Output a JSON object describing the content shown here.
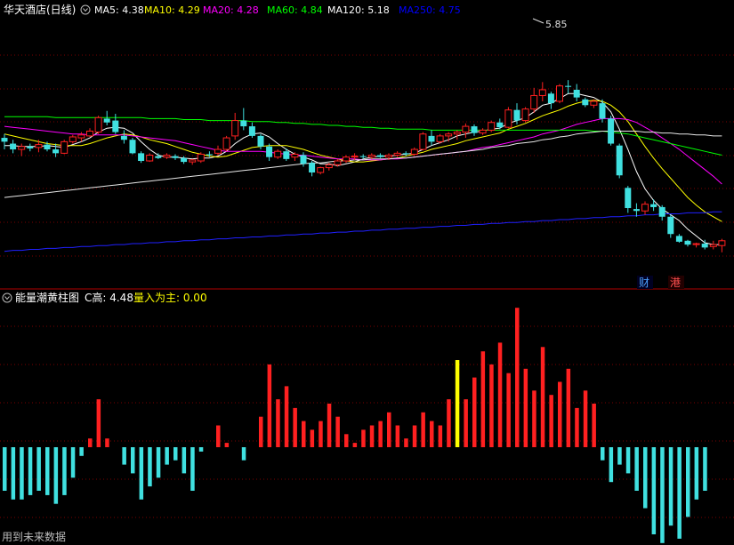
{
  "main_chart": {
    "stock_name": "华天酒店(日线)",
    "ma_legend": [
      {
        "label": "MA5: 4.38",
        "color": "#ffffff"
      },
      {
        "label": "MA10: 4.29",
        "color": "#ffff00"
      },
      {
        "label": "MA20: 4.28",
        "color": "#ff00ff"
      },
      {
        "label": "MA60: 4.84",
        "color": "#00ff00"
      },
      {
        "label": "MA120: 5.18",
        "color": "#ffffff"
      },
      {
        "label": "MA250: 4.75",
        "color": "#0000ff"
      }
    ],
    "high_marker": "5.85",
    "badge_cai": "财",
    "badge_gang": "港"
  },
  "indicator": {
    "name": "能量潮黄柱图",
    "c_high": "C高: 4.48",
    "main_flow": "量入为主: 0.00",
    "footer_note": "用到未来数据"
  },
  "colors": {
    "bg": "#000000",
    "border": "#b00000",
    "grid": "#7a0000",
    "up": "#ff2020",
    "down": "#40e0e0",
    "yellow_bar": "#ffff00"
  },
  "chart_data": {
    "type": "candlestick",
    "candles": [
      [
        4.72,
        4.76,
        4.6,
        4.68
      ],
      [
        4.66,
        4.7,
        4.56,
        4.6
      ],
      [
        4.6,
        4.66,
        4.53,
        4.63
      ],
      [
        4.63,
        4.66,
        4.58,
        4.61
      ],
      [
        4.62,
        4.7,
        4.57,
        4.65
      ],
      [
        4.65,
        4.68,
        4.58,
        4.6
      ],
      [
        4.6,
        4.66,
        4.52,
        4.56
      ],
      [
        4.56,
        4.7,
        4.55,
        4.68
      ],
      [
        4.68,
        4.75,
        4.66,
        4.73
      ],
      [
        4.72,
        4.78,
        4.68,
        4.75
      ],
      [
        4.74,
        4.82,
        4.73,
        4.79
      ],
      [
        4.78,
        4.95,
        4.76,
        4.93
      ],
      [
        4.92,
        5.0,
        4.85,
        4.88
      ],
      [
        4.9,
        4.97,
        4.76,
        4.78
      ],
      [
        4.74,
        4.8,
        4.66,
        4.7
      ],
      [
        4.7,
        4.72,
        4.55,
        4.56
      ],
      [
        4.56,
        4.58,
        4.46,
        4.48
      ],
      [
        4.48,
        4.56,
        4.47,
        4.54
      ],
      [
        4.53,
        4.56,
        4.5,
        4.51
      ],
      [
        4.52,
        4.56,
        4.5,
        4.54
      ],
      [
        4.53,
        4.55,
        4.49,
        4.51
      ],
      [
        4.51,
        4.53,
        4.45,
        4.47
      ],
      [
        4.47,
        4.5,
        4.44,
        4.49
      ],
      [
        4.48,
        4.57,
        4.46,
        4.55
      ],
      [
        4.55,
        4.58,
        4.52,
        4.54
      ],
      [
        4.56,
        4.64,
        4.54,
        4.6
      ],
      [
        4.6,
        4.74,
        4.58,
        4.72
      ],
      [
        4.74,
        4.98,
        4.7,
        4.9
      ],
      [
        4.9,
        5.03,
        4.8,
        4.84
      ],
      [
        4.84,
        4.88,
        4.72,
        4.74
      ],
      [
        4.74,
        4.76,
        4.6,
        4.63
      ],
      [
        4.63,
        4.66,
        4.48,
        4.52
      ],
      [
        4.52,
        4.6,
        4.5,
        4.58
      ],
      [
        4.58,
        4.61,
        4.48,
        4.5
      ],
      [
        4.52,
        4.57,
        4.48,
        4.55
      ],
      [
        4.54,
        4.57,
        4.42,
        4.45
      ],
      [
        4.46,
        4.48,
        4.32,
        4.36
      ],
      [
        4.36,
        4.42,
        4.34,
        4.41
      ],
      [
        4.41,
        4.46,
        4.38,
        4.44
      ],
      [
        4.44,
        4.5,
        4.42,
        4.48
      ],
      [
        4.48,
        4.54,
        4.46,
        4.52
      ],
      [
        4.52,
        4.56,
        4.49,
        4.53
      ],
      [
        4.53,
        4.55,
        4.5,
        4.52
      ],
      [
        4.52,
        4.56,
        4.5,
        4.54
      ],
      [
        4.54,
        4.56,
        4.51,
        4.52
      ],
      [
        4.52,
        4.56,
        4.49,
        4.54
      ],
      [
        4.54,
        4.58,
        4.52,
        4.56
      ],
      [
        4.56,
        4.58,
        4.53,
        4.55
      ],
      [
        4.55,
        4.62,
        4.53,
        4.6
      ],
      [
        4.6,
        4.78,
        4.59,
        4.76
      ],
      [
        4.74,
        4.8,
        4.64,
        4.68
      ],
      [
        4.68,
        4.76,
        4.66,
        4.74
      ],
      [
        4.74,
        4.78,
        4.68,
        4.76
      ],
      [
        4.76,
        4.8,
        4.7,
        4.78
      ],
      [
        4.78,
        4.87,
        4.72,
        4.84
      ],
      [
        4.84,
        4.86,
        4.74,
        4.77
      ],
      [
        4.77,
        4.82,
        4.75,
        4.8
      ],
      [
        4.8,
        4.9,
        4.78,
        4.88
      ],
      [
        4.88,
        4.92,
        4.81,
        4.83
      ],
      [
        4.83,
        5.04,
        4.82,
        5.01
      ],
      [
        5.01,
        5.08,
        4.86,
        4.9
      ],
      [
        4.9,
        5.04,
        4.88,
        5.02
      ],
      [
        5.02,
        5.24,
        4.98,
        5.16
      ],
      [
        5.16,
        5.3,
        5.1,
        5.22
      ],
      [
        5.18,
        5.2,
        5.02,
        5.08
      ],
      [
        5.1,
        5.28,
        5.08,
        5.26
      ],
      [
        5.26,
        5.32,
        5.18,
        5.25
      ],
      [
        5.22,
        5.28,
        5.1,
        5.14
      ],
      [
        5.12,
        5.14,
        5.04,
        5.06
      ],
      [
        5.06,
        5.12,
        5.03,
        5.1
      ],
      [
        5.08,
        5.12,
        4.88,
        4.92
      ],
      [
        4.92,
        4.95,
        4.64,
        4.66
      ],
      [
        4.64,
        4.66,
        4.3,
        4.33
      ],
      [
        4.2,
        4.22,
        3.94,
        3.99
      ],
      [
        3.98,
        4.04,
        3.9,
        3.96
      ],
      [
        3.96,
        4.06,
        3.92,
        4.03
      ],
      [
        4.03,
        4.08,
        3.96,
        4.0
      ],
      [
        4.0,
        4.02,
        3.86,
        3.9
      ],
      [
        3.9,
        3.92,
        3.68,
        3.72
      ],
      [
        3.7,
        3.72,
        3.63,
        3.64
      ],
      [
        3.65,
        3.66,
        3.59,
        3.61
      ],
      [
        3.61,
        3.63,
        3.58,
        3.62
      ],
      [
        3.62,
        3.66,
        3.56,
        3.58
      ],
      [
        3.59,
        3.65,
        3.56,
        3.61
      ],
      [
        3.6,
        3.67,
        3.53,
        3.65
      ]
    ],
    "ma": {
      "MA5": [
        4.64,
        4.64,
        4.63,
        4.63,
        4.63,
        4.64,
        4.63,
        4.62,
        4.65,
        4.68,
        4.72,
        4.78,
        4.82,
        4.83,
        4.82,
        4.77,
        4.68,
        4.6,
        4.54,
        4.52,
        4.52,
        4.51,
        4.5,
        4.51,
        4.51,
        4.53,
        4.58,
        4.66,
        4.72,
        4.76,
        4.77,
        4.73,
        4.66,
        4.6,
        4.55,
        4.52,
        4.49,
        4.45,
        4.45,
        4.43,
        4.45,
        4.47,
        4.5,
        4.52,
        4.53,
        4.53,
        4.54,
        4.55,
        4.56,
        4.6,
        4.64,
        4.67,
        4.7,
        4.74,
        4.76,
        4.78,
        4.79,
        4.81,
        4.82,
        4.87,
        4.9,
        4.93,
        4.99,
        5.06,
        5.08,
        5.13,
        5.18,
        5.18,
        5.16,
        5.14,
        5.09,
        4.99,
        4.81,
        4.6,
        4.37,
        4.19,
        4.07,
        3.98,
        3.92,
        3.86,
        3.77,
        3.7,
        3.63,
        3.61,
        3.61
      ],
      "MA10": [
        4.76,
        4.74,
        4.72,
        4.7,
        4.68,
        4.66,
        4.65,
        4.64,
        4.64,
        4.64,
        4.66,
        4.69,
        4.72,
        4.74,
        4.76,
        4.75,
        4.73,
        4.7,
        4.68,
        4.66,
        4.63,
        4.6,
        4.57,
        4.55,
        4.53,
        4.52,
        4.53,
        4.56,
        4.59,
        4.62,
        4.63,
        4.64,
        4.64,
        4.64,
        4.62,
        4.6,
        4.57,
        4.54,
        4.52,
        4.5,
        4.48,
        4.47,
        4.47,
        4.48,
        4.49,
        4.5,
        4.51,
        4.53,
        4.55,
        4.57,
        4.6,
        4.62,
        4.64,
        4.66,
        4.69,
        4.71,
        4.73,
        4.75,
        4.77,
        4.81,
        4.84,
        4.87,
        4.91,
        4.95,
        4.98,
        5.01,
        5.05,
        5.08,
        5.1,
        5.11,
        5.1,
        5.06,
        4.99,
        4.89,
        4.76,
        4.63,
        4.51,
        4.4,
        4.3,
        4.2,
        4.1,
        4.02,
        3.95,
        3.9,
        3.85
      ],
      "MA20": [
        4.84,
        4.83,
        4.82,
        4.81,
        4.8,
        4.79,
        4.78,
        4.77,
        4.76,
        4.76,
        4.75,
        4.75,
        4.75,
        4.75,
        4.75,
        4.74,
        4.73,
        4.72,
        4.71,
        4.7,
        4.69,
        4.67,
        4.65,
        4.63,
        4.61,
        4.59,
        4.58,
        4.58,
        4.58,
        4.58,
        4.58,
        4.57,
        4.56,
        4.55,
        4.54,
        4.54,
        4.53,
        4.52,
        4.51,
        4.5,
        4.5,
        4.5,
        4.49,
        4.49,
        4.49,
        4.5,
        4.5,
        4.51,
        4.52,
        4.53,
        4.54,
        4.55,
        4.56,
        4.57,
        4.58,
        4.6,
        4.62,
        4.63,
        4.65,
        4.67,
        4.69,
        4.71,
        4.73,
        4.76,
        4.78,
        4.8,
        4.83,
        4.86,
        4.88,
        4.9,
        4.92,
        4.92,
        4.92,
        4.91,
        4.88,
        4.83,
        4.78,
        4.72,
        4.66,
        4.6,
        4.53,
        4.46,
        4.39,
        4.32,
        4.24
      ],
      "MA60": [
        4.94,
        4.94,
        4.94,
        4.94,
        4.94,
        4.94,
        4.93,
        4.93,
        4.93,
        4.93,
        4.93,
        4.93,
        4.93,
        4.93,
        4.93,
        4.93,
        4.93,
        4.92,
        4.92,
        4.92,
        4.92,
        4.91,
        4.91,
        4.91,
        4.9,
        4.9,
        4.9,
        4.9,
        4.9,
        4.89,
        4.89,
        4.89,
        4.88,
        4.88,
        4.87,
        4.87,
        4.86,
        4.86,
        4.85,
        4.85,
        4.84,
        4.84,
        4.83,
        4.83,
        4.82,
        4.82,
        4.81,
        4.81,
        4.81,
        4.81,
        4.8,
        4.8,
        4.8,
        4.8,
        4.8,
        4.8,
        4.8,
        4.8,
        4.8,
        4.8,
        4.8,
        4.8,
        4.8,
        4.8,
        4.8,
        4.8,
        4.8,
        4.8,
        4.8,
        4.79,
        4.79,
        4.78,
        4.77,
        4.76,
        4.74,
        4.72,
        4.7,
        4.68,
        4.66,
        4.64,
        4.62,
        4.6,
        4.58,
        4.56,
        4.54
      ],
      "MA120": [
        4.1,
        4.11,
        4.12,
        4.13,
        4.14,
        4.15,
        4.16,
        4.17,
        4.18,
        4.19,
        4.2,
        4.21,
        4.22,
        4.23,
        4.24,
        4.25,
        4.26,
        4.27,
        4.28,
        4.29,
        4.3,
        4.31,
        4.32,
        4.33,
        4.34,
        4.35,
        4.36,
        4.37,
        4.38,
        4.39,
        4.4,
        4.41,
        4.42,
        4.43,
        4.44,
        4.45,
        4.46,
        4.46,
        4.47,
        4.48,
        4.48,
        4.49,
        4.49,
        4.5,
        4.5,
        4.5,
        4.51,
        4.51,
        4.52,
        4.53,
        4.54,
        4.55,
        4.56,
        4.57,
        4.58,
        4.59,
        4.6,
        4.62,
        4.63,
        4.64,
        4.66,
        4.67,
        4.68,
        4.7,
        4.71,
        4.73,
        4.74,
        4.76,
        4.77,
        4.78,
        4.79,
        4.79,
        4.79,
        4.79,
        4.79,
        4.78,
        4.78,
        4.77,
        4.77,
        4.76,
        4.76,
        4.75,
        4.75,
        4.74,
        4.74
      ],
      "MA250": [
        3.54,
        3.55,
        3.55,
        3.56,
        3.56,
        3.57,
        3.57,
        3.58,
        3.58,
        3.59,
        3.59,
        3.6,
        3.6,
        3.61,
        3.61,
        3.62,
        3.62,
        3.63,
        3.63,
        3.64,
        3.64,
        3.65,
        3.65,
        3.66,
        3.66,
        3.67,
        3.67,
        3.68,
        3.68,
        3.69,
        3.69,
        3.7,
        3.7,
        3.71,
        3.71,
        3.72,
        3.72,
        3.73,
        3.73,
        3.74,
        3.74,
        3.75,
        3.75,
        3.76,
        3.76,
        3.77,
        3.77,
        3.78,
        3.78,
        3.79,
        3.79,
        3.8,
        3.8,
        3.81,
        3.81,
        3.82,
        3.82,
        3.83,
        3.83,
        3.84,
        3.84,
        3.85,
        3.85,
        3.86,
        3.86,
        3.87,
        3.87,
        3.88,
        3.88,
        3.89,
        3.89,
        3.9,
        3.9,
        3.91,
        3.91,
        3.92,
        3.92,
        3.93,
        3.93,
        3.93,
        3.94,
        3.94,
        3.94,
        3.95,
        3.95
      ]
    },
    "indicator_values": [
      -0.5,
      -0.6,
      -0.6,
      -0.55,
      -0.5,
      -0.55,
      -0.65,
      -0.55,
      -0.35,
      -0.1,
      0.1,
      0.55,
      0.1,
      0,
      -0.2,
      -0.3,
      -0.6,
      -0.45,
      -0.35,
      -0.2,
      -0.15,
      -0.3,
      -0.5,
      -0.05,
      0,
      0.25,
      0.05,
      0,
      -0.15,
      0,
      0.35,
      0.95,
      0.55,
      0.7,
      0.45,
      0.3,
      0.2,
      0.3,
      0.5,
      0.35,
      0.15,
      0.05,
      0.2,
      0.25,
      0.3,
      0.4,
      0.25,
      0.1,
      0.25,
      0.4,
      0.3,
      0.25,
      0.55,
      1.0,
      0.55,
      0.8,
      1.1,
      0.95,
      1.2,
      0.85,
      1.6,
      0.9,
      0.65,
      1.15,
      0.6,
      0.75,
      0.9,
      0.45,
      0.65,
      0.5,
      -0.15,
      -0.4,
      -0.2,
      -0.3,
      -0.5,
      -0.7,
      -1.0,
      -1.1,
      -0.9,
      -1.05,
      -0.8,
      -0.6,
      -0.5
    ],
    "yellow_index": 53
  }
}
